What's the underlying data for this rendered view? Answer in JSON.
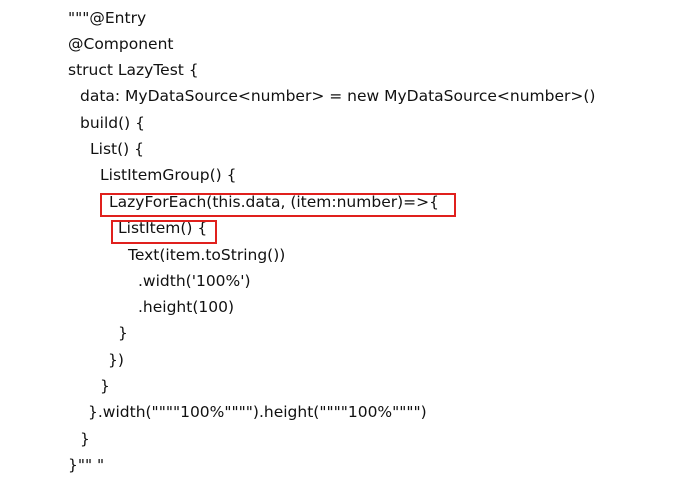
{
  "code": {
    "lines": [
      "\"\"\"@Entry",
      "@Component",
      "struct LazyTest {",
      "data: MyDataSource<number> = new MyDataSource<number>()",
      "build() {",
      "List() {",
      "ListItemGroup() {",
      "LazyForEach(this.data, (item:number)=>{",
      "ListItem() {",
      "Text(item.toString())",
      ".width('100%')",
      ".height(100)",
      "}",
      "})",
      "}",
      "}.width(\"\"\"\"100%\"\"\"\").height(\"\"\"\"100%\"\"\"\")",
      "}",
      "}\"\" \""
    ]
  },
  "highlights": {
    "color": "#e0201d",
    "items": [
      "LazyForEach call",
      "ListItem call"
    ]
  }
}
